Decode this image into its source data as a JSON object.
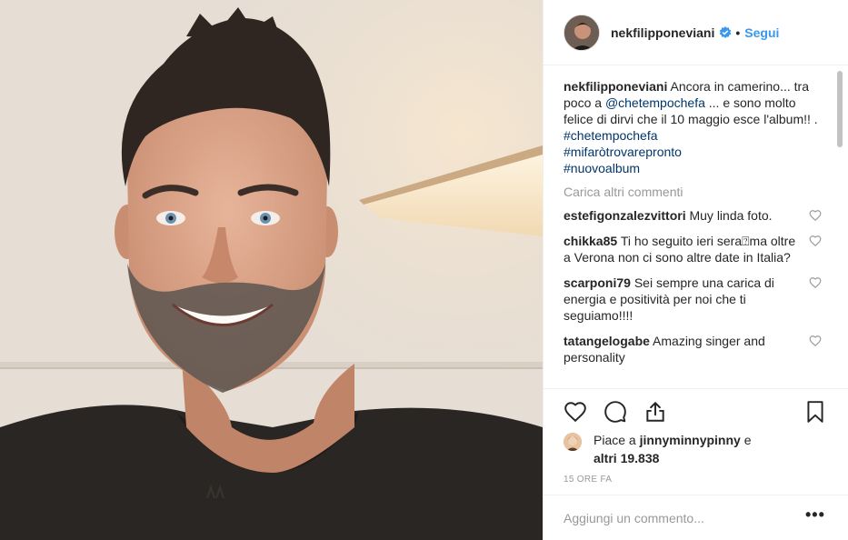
{
  "post": {
    "photo_icon": "selfie-photo"
  },
  "header": {
    "username": "nekfilipponeviani",
    "verified_icon": "verified-badge-icon",
    "separator": "•",
    "follow_label": "Segui"
  },
  "caption": {
    "username": "nekfilipponeviani",
    "text_1": "Ancora in camerino... tra poco a",
    "mention": "@chetempochefa",
    "text_2": "... e sono molto felice di dirvi che il 10 maggio esce l'album!! .",
    "hashtags": [
      "#chetempochefa",
      "#mifaròtrovarepronto",
      "#nuovoalbum"
    ]
  },
  "load_more_label": "Carica altri commenti",
  "comments": [
    {
      "username": "estefigonzalezvittori",
      "text": "Muy linda foto."
    },
    {
      "username": "chikka85",
      "text": "Ti ho seguito ieri sera⍰ma oltre a Verona non ci sono altre date in Italia?"
    },
    {
      "username": "scarponi79",
      "text": "Sei sempre una carica di energia e positività per noi che ti seguiamo!!!!"
    },
    {
      "username": "tatangelogabe",
      "text": "Amazing singer and personality"
    }
  ],
  "actions": {
    "like_icon": "heart-icon",
    "comment_icon": "comment-icon",
    "share_icon": "share-icon",
    "save_icon": "bookmark-icon"
  },
  "likes": {
    "prefix": "Piace a",
    "user": "jinnyminnypinny",
    "conj": "e",
    "others": "altri 19.838"
  },
  "timestamp": "15 ORE FA",
  "add_comment": {
    "placeholder": "Aggiungi un commento...",
    "more_label": "•••"
  },
  "colors": {
    "link": "#003569",
    "follow": "#3897f0",
    "secondary": "#999999",
    "border": "#efefef"
  }
}
